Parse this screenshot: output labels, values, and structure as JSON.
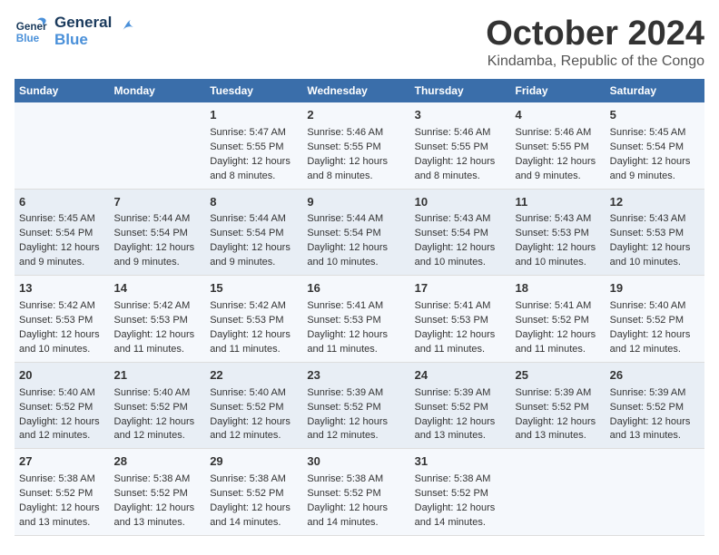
{
  "logo": {
    "line1": "General",
    "line2": "Blue"
  },
  "title": "October 2024",
  "subtitle": "Kindamba, Republic of the Congo",
  "days": [
    "Sunday",
    "Monday",
    "Tuesday",
    "Wednesday",
    "Thursday",
    "Friday",
    "Saturday"
  ],
  "weeks": [
    [
      {
        "date": "",
        "sunrise": "",
        "sunset": "",
        "daylight": ""
      },
      {
        "date": "",
        "sunrise": "",
        "sunset": "",
        "daylight": ""
      },
      {
        "date": "1",
        "sunrise": "Sunrise: 5:47 AM",
        "sunset": "Sunset: 5:55 PM",
        "daylight": "Daylight: 12 hours and 8 minutes."
      },
      {
        "date": "2",
        "sunrise": "Sunrise: 5:46 AM",
        "sunset": "Sunset: 5:55 PM",
        "daylight": "Daylight: 12 hours and 8 minutes."
      },
      {
        "date": "3",
        "sunrise": "Sunrise: 5:46 AM",
        "sunset": "Sunset: 5:55 PM",
        "daylight": "Daylight: 12 hours and 8 minutes."
      },
      {
        "date": "4",
        "sunrise": "Sunrise: 5:46 AM",
        "sunset": "Sunset: 5:55 PM",
        "daylight": "Daylight: 12 hours and 9 minutes."
      },
      {
        "date": "5",
        "sunrise": "Sunrise: 5:45 AM",
        "sunset": "Sunset: 5:54 PM",
        "daylight": "Daylight: 12 hours and 9 minutes."
      }
    ],
    [
      {
        "date": "6",
        "sunrise": "Sunrise: 5:45 AM",
        "sunset": "Sunset: 5:54 PM",
        "daylight": "Daylight: 12 hours and 9 minutes."
      },
      {
        "date": "7",
        "sunrise": "Sunrise: 5:44 AM",
        "sunset": "Sunset: 5:54 PM",
        "daylight": "Daylight: 12 hours and 9 minutes."
      },
      {
        "date": "8",
        "sunrise": "Sunrise: 5:44 AM",
        "sunset": "Sunset: 5:54 PM",
        "daylight": "Daylight: 12 hours and 9 minutes."
      },
      {
        "date": "9",
        "sunrise": "Sunrise: 5:44 AM",
        "sunset": "Sunset: 5:54 PM",
        "daylight": "Daylight: 12 hours and 10 minutes."
      },
      {
        "date": "10",
        "sunrise": "Sunrise: 5:43 AM",
        "sunset": "Sunset: 5:54 PM",
        "daylight": "Daylight: 12 hours and 10 minutes."
      },
      {
        "date": "11",
        "sunrise": "Sunrise: 5:43 AM",
        "sunset": "Sunset: 5:53 PM",
        "daylight": "Daylight: 12 hours and 10 minutes."
      },
      {
        "date": "12",
        "sunrise": "Sunrise: 5:43 AM",
        "sunset": "Sunset: 5:53 PM",
        "daylight": "Daylight: 12 hours and 10 minutes."
      }
    ],
    [
      {
        "date": "13",
        "sunrise": "Sunrise: 5:42 AM",
        "sunset": "Sunset: 5:53 PM",
        "daylight": "Daylight: 12 hours and 10 minutes."
      },
      {
        "date": "14",
        "sunrise": "Sunrise: 5:42 AM",
        "sunset": "Sunset: 5:53 PM",
        "daylight": "Daylight: 12 hours and 11 minutes."
      },
      {
        "date": "15",
        "sunrise": "Sunrise: 5:42 AM",
        "sunset": "Sunset: 5:53 PM",
        "daylight": "Daylight: 12 hours and 11 minutes."
      },
      {
        "date": "16",
        "sunrise": "Sunrise: 5:41 AM",
        "sunset": "Sunset: 5:53 PM",
        "daylight": "Daylight: 12 hours and 11 minutes."
      },
      {
        "date": "17",
        "sunrise": "Sunrise: 5:41 AM",
        "sunset": "Sunset: 5:53 PM",
        "daylight": "Daylight: 12 hours and 11 minutes."
      },
      {
        "date": "18",
        "sunrise": "Sunrise: 5:41 AM",
        "sunset": "Sunset: 5:52 PM",
        "daylight": "Daylight: 12 hours and 11 minutes."
      },
      {
        "date": "19",
        "sunrise": "Sunrise: 5:40 AM",
        "sunset": "Sunset: 5:52 PM",
        "daylight": "Daylight: 12 hours and 12 minutes."
      }
    ],
    [
      {
        "date": "20",
        "sunrise": "Sunrise: 5:40 AM",
        "sunset": "Sunset: 5:52 PM",
        "daylight": "Daylight: 12 hours and 12 minutes."
      },
      {
        "date": "21",
        "sunrise": "Sunrise: 5:40 AM",
        "sunset": "Sunset: 5:52 PM",
        "daylight": "Daylight: 12 hours and 12 minutes."
      },
      {
        "date": "22",
        "sunrise": "Sunrise: 5:40 AM",
        "sunset": "Sunset: 5:52 PM",
        "daylight": "Daylight: 12 hours and 12 minutes."
      },
      {
        "date": "23",
        "sunrise": "Sunrise: 5:39 AM",
        "sunset": "Sunset: 5:52 PM",
        "daylight": "Daylight: 12 hours and 12 minutes."
      },
      {
        "date": "24",
        "sunrise": "Sunrise: 5:39 AM",
        "sunset": "Sunset: 5:52 PM",
        "daylight": "Daylight: 12 hours and 13 minutes."
      },
      {
        "date": "25",
        "sunrise": "Sunrise: 5:39 AM",
        "sunset": "Sunset: 5:52 PM",
        "daylight": "Daylight: 12 hours and 13 minutes."
      },
      {
        "date": "26",
        "sunrise": "Sunrise: 5:39 AM",
        "sunset": "Sunset: 5:52 PM",
        "daylight": "Daylight: 12 hours and 13 minutes."
      }
    ],
    [
      {
        "date": "27",
        "sunrise": "Sunrise: 5:38 AM",
        "sunset": "Sunset: 5:52 PM",
        "daylight": "Daylight: 12 hours and 13 minutes."
      },
      {
        "date": "28",
        "sunrise": "Sunrise: 5:38 AM",
        "sunset": "Sunset: 5:52 PM",
        "daylight": "Daylight: 12 hours and 13 minutes."
      },
      {
        "date": "29",
        "sunrise": "Sunrise: 5:38 AM",
        "sunset": "Sunset: 5:52 PM",
        "daylight": "Daylight: 12 hours and 14 minutes."
      },
      {
        "date": "30",
        "sunrise": "Sunrise: 5:38 AM",
        "sunset": "Sunset: 5:52 PM",
        "daylight": "Daylight: 12 hours and 14 minutes."
      },
      {
        "date": "31",
        "sunrise": "Sunrise: 5:38 AM",
        "sunset": "Sunset: 5:52 PM",
        "daylight": "Daylight: 12 hours and 14 minutes."
      },
      {
        "date": "",
        "sunrise": "",
        "sunset": "",
        "daylight": ""
      },
      {
        "date": "",
        "sunrise": "",
        "sunset": "",
        "daylight": ""
      }
    ]
  ]
}
